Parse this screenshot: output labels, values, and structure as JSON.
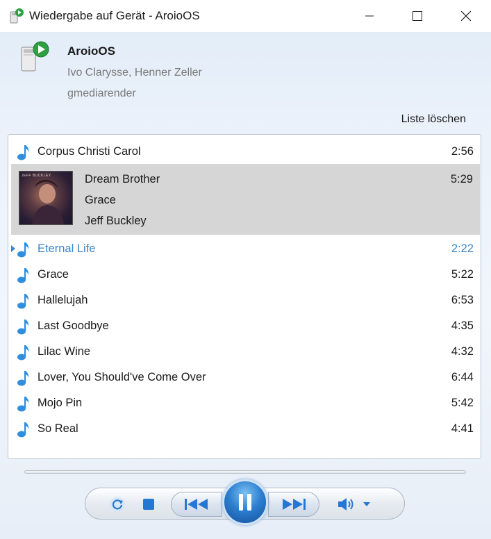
{
  "window": {
    "title": "Wiedergabe auf Gerät - AroioOS"
  },
  "device": {
    "name": "AroioOS",
    "authors": "Ivo Clarysse, Henner Zeller",
    "renderer": "gmediarender"
  },
  "playlist": {
    "clear_label": "Liste löschen",
    "first": {
      "title": "Corpus Christi Carol",
      "duration": "2:56"
    },
    "selected": {
      "title": "Dream Brother",
      "album": "Grace",
      "artist": "Jeff Buckley",
      "duration": "5:29",
      "cover_text": "JEFF BUCKLEY"
    },
    "items": [
      {
        "title": "Eternal Life",
        "duration": "2:22"
      },
      {
        "title": "Grace",
        "duration": "5:22"
      },
      {
        "title": "Hallelujah",
        "duration": "6:53"
      },
      {
        "title": "Last Goodbye",
        "duration": "4:35"
      },
      {
        "title": "Lilac Wine",
        "duration": "4:32"
      },
      {
        "title": "Lover, You Should've Come Over",
        "duration": "6:44"
      },
      {
        "title": "Mojo Pin",
        "duration": "5:42"
      },
      {
        "title": "So Real",
        "duration": "4:41"
      }
    ]
  },
  "controls": {
    "icons": [
      "repeat-icon",
      "stop-icon",
      "previous-icon",
      "pause-icon",
      "next-icon",
      "volume-icon",
      "dropdown-arrow-icon"
    ]
  },
  "colors": {
    "accent": "#3a86cc",
    "selected_row": "#d6d6d6",
    "note_icon": "#2e8ee0"
  }
}
